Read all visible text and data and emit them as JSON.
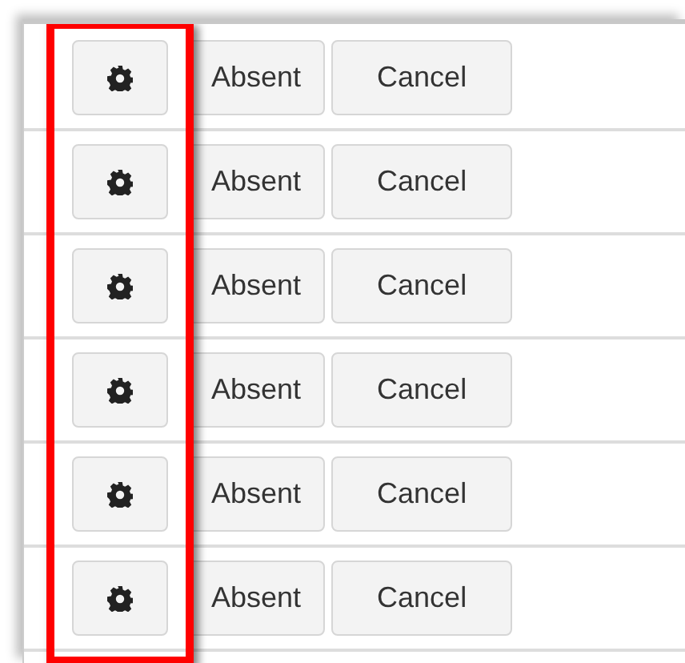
{
  "rows": [
    {
      "absent_label": "Absent",
      "cancel_label": "Cancel"
    },
    {
      "absent_label": "Absent",
      "cancel_label": "Cancel"
    },
    {
      "absent_label": "Absent",
      "cancel_label": "Cancel"
    },
    {
      "absent_label": "Absent",
      "cancel_label": "Cancel"
    },
    {
      "absent_label": "Absent",
      "cancel_label": "Cancel"
    },
    {
      "absent_label": "Absent",
      "cancel_label": "Cancel"
    }
  ],
  "annotation": {
    "kind": "highlight-box"
  }
}
